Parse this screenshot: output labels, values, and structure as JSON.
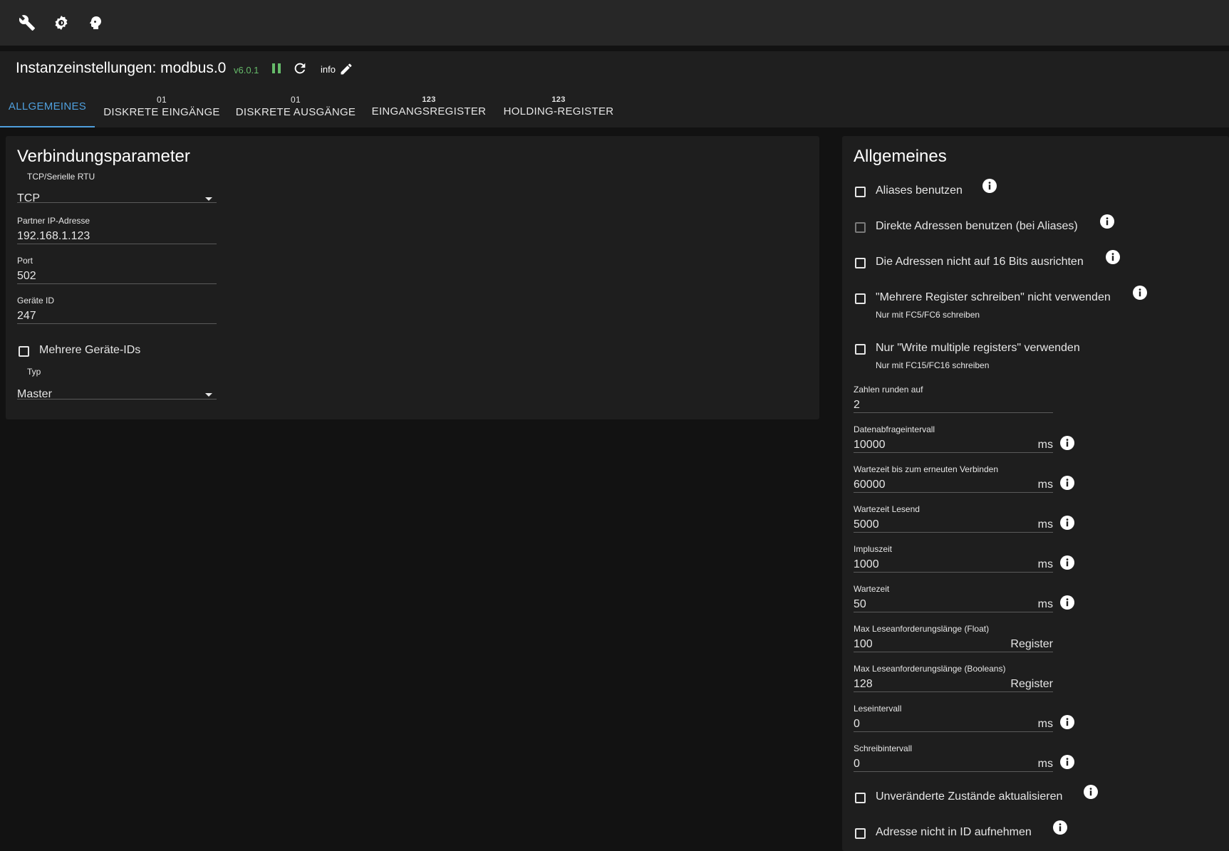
{
  "toolbar": {
    "icons": [
      "wrench-icon",
      "settings-icon",
      "face-icon"
    ]
  },
  "header": {
    "title": "Instanzeinstellungen: modbus.0",
    "version": "v6.0.1",
    "info_label": "info",
    "colors": {
      "version": "#66bb6a",
      "accent": "#4f9fdd"
    }
  },
  "tabs": [
    {
      "label": "ALLGEMEINES",
      "badge": "",
      "active": true
    },
    {
      "label": "DISKRETE EINGÄNGE",
      "badge": "01"
    },
    {
      "label": "DISKRETE AUSGÄNGE",
      "badge": "01"
    },
    {
      "label": "EINGANGSREGISTER",
      "badge": "123"
    },
    {
      "label": "HOLDING-REGISTER",
      "badge": "123"
    }
  ],
  "connection": {
    "title": "Verbindungsparameter",
    "mode": {
      "label": "TCP/Serielle RTU",
      "value": "TCP"
    },
    "ip": {
      "label": "Partner IP-Adresse",
      "value": "192.168.1.123"
    },
    "port": {
      "label": "Port",
      "value": "502"
    },
    "device_id": {
      "label": "Geräte ID",
      "value": "247"
    },
    "multi_ids": {
      "label": "Mehrere Geräte-IDs",
      "checked": false
    },
    "type": {
      "label": "Typ",
      "value": "Master"
    }
  },
  "general": {
    "title": "Allgemeines",
    "checkboxes": [
      {
        "label": "Aliases benutzen",
        "sub": "",
        "checked": false
      },
      {
        "label": "Direkte Adressen benutzen (bei Aliases)",
        "sub": "",
        "checked": false,
        "disabled": true
      },
      {
        "label": "Die Adressen nicht auf 16 Bits ausrichten",
        "sub": "",
        "checked": false
      },
      {
        "label": "\"Mehrere Register schreiben\" nicht verwenden",
        "sub": "Nur mit FC5/FC6 schreiben",
        "checked": false
      },
      {
        "label": "Nur \"Write multiple registers\" verwenden",
        "sub": "Nur mit FC15/FC16 schreiben",
        "checked": false
      }
    ],
    "fields": [
      {
        "label": "Zahlen runden auf",
        "value": "2",
        "unit": ""
      },
      {
        "label": "Datenabfrageintervall",
        "value": "10000",
        "unit": "ms"
      },
      {
        "label": "Wartezeit bis zum erneuten Verbinden",
        "value": "60000",
        "unit": "ms"
      },
      {
        "label": "Wartezeit Lesend",
        "value": "5000",
        "unit": "ms"
      },
      {
        "label": "Impluszeit",
        "value": "1000",
        "unit": "ms"
      },
      {
        "label": "Wartezeit",
        "value": "50",
        "unit": "ms"
      },
      {
        "label": "Max Leseanforderungslänge (Float)",
        "value": "100",
        "unit": "Register"
      },
      {
        "label": "Max Leseanforderungslänge (Booleans)",
        "value": "128",
        "unit": "Register"
      },
      {
        "label": "Leseintervall",
        "value": "0",
        "unit": "ms"
      },
      {
        "label": "Schreibintervall",
        "value": "0",
        "unit": "ms"
      }
    ],
    "bottom_checkboxes": [
      {
        "label": "Unveränderte Zustände aktualisieren",
        "checked": false
      },
      {
        "label": "Adresse nicht in ID aufnehmen",
        "checked": false
      }
    ]
  }
}
